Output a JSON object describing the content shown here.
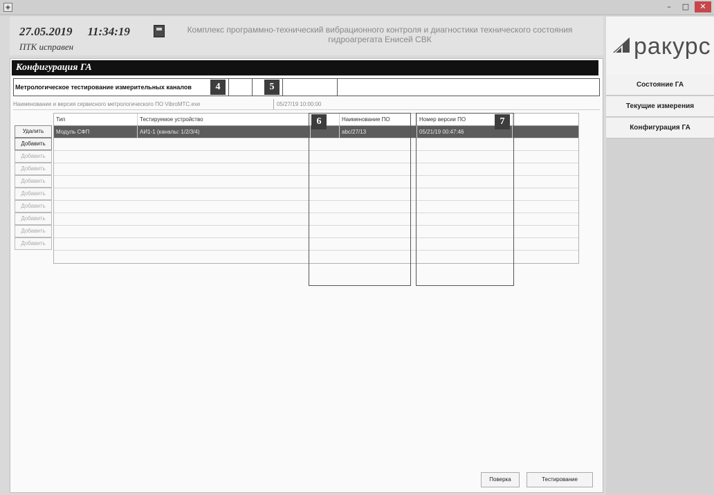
{
  "window": {
    "app_icon": "app-icon",
    "minimize": "–",
    "maximize": "□",
    "close": "✕"
  },
  "header": {
    "date": "27.05.2019",
    "time": "11:34:19",
    "status": "ПТК исправен",
    "system_title": "Комплекс программно-технический вибрационного контроля и диагностики технического состояния гидроагрегата Енисей СВК"
  },
  "logo": {
    "text": "ракурс"
  },
  "sidebar": {
    "items": [
      {
        "label": "Состояние ГА"
      },
      {
        "label": "Текущие измерения"
      },
      {
        "label": "Конфигурация ГА"
      }
    ]
  },
  "panel": {
    "title": "Конфигурация ГА",
    "metro_label": "Метрологическое тестирование измерительных каналов",
    "markers": [
      "4",
      "5",
      "6",
      "7"
    ],
    "version_label": "Наименование и версия сервисного метрологического ПО VibroMTC.exe",
    "version_value": "05/27/19 10:00:00"
  },
  "table": {
    "columns": [
      "Тип",
      "Тестируемое устройство",
      "Наименование ПО",
      "Номер версии ПО"
    ],
    "rows": [
      [
        "Модуль СФП",
        "АИ1-1 (каналы: 1/2/3/4)",
        "abc/27/13",
        "05/21/19 00:47:46"
      ]
    ],
    "actions": {
      "delete": "Удалить",
      "add": "Добавить"
    }
  },
  "footer": {
    "verify": "Поверка",
    "testing": "Тестирование"
  }
}
